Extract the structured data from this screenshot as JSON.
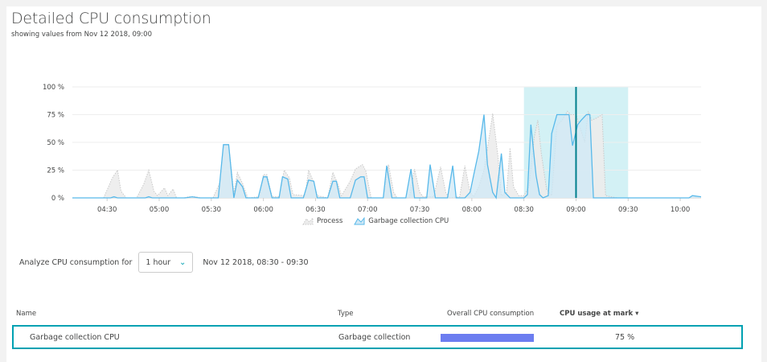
{
  "header": {
    "title": "Detailed CPU consumption",
    "subtitle": "showing values from Nov 12 2018, 09:00"
  },
  "colors": {
    "accent": "#00a1b2",
    "gc_line": "#58b9ea",
    "gc_fill": "#cfe8f6",
    "process_line": "#c8c8c8",
    "process_fill": "#ececec",
    "selection": "#d3f1f5",
    "bar": "#6c7df0"
  },
  "chart_data": {
    "type": "area",
    "title": "",
    "xlabel": "",
    "ylabel": "",
    "x_ticks": [
      "04:30",
      "05:00",
      "05:30",
      "06:00",
      "06:30",
      "07:00",
      "07:30",
      "08:00",
      "08:30",
      "09:00",
      "09:30",
      "10:00"
    ],
    "y_ticks": [
      "0 %",
      "25 %",
      "50 %",
      "75 %",
      "100 %"
    ],
    "x_range": [
      "04:10",
      "10:12"
    ],
    "ylim": [
      0,
      100
    ],
    "grid": true,
    "legend_position": "bottom",
    "selection_range": [
      "08:30",
      "09:30"
    ],
    "marker_time": "09:00",
    "series": [
      {
        "name": "Process",
        "style": "dotted-area",
        "points": [
          [
            "04:10",
            0
          ],
          [
            "04:28",
            0
          ],
          [
            "04:33",
            18
          ],
          [
            "04:36",
            25
          ],
          [
            "04:38",
            6
          ],
          [
            "04:41",
            0
          ],
          [
            "04:47",
            0
          ],
          [
            "04:51",
            12
          ],
          [
            "04:54",
            25
          ],
          [
            "04:57",
            6
          ],
          [
            "04:59",
            2
          ],
          [
            "05:03",
            9
          ],
          [
            "05:05",
            2
          ],
          [
            "05:08",
            8
          ],
          [
            "05:10",
            0
          ],
          [
            "05:14",
            0
          ],
          [
            "05:17",
            1
          ],
          [
            "05:21",
            1
          ],
          [
            "05:24",
            0
          ],
          [
            "05:31",
            0
          ],
          [
            "05:35",
            14
          ],
          [
            "05:37",
            48
          ],
          [
            "05:40",
            48
          ],
          [
            "05:43",
            4
          ],
          [
            "05:45",
            23
          ],
          [
            "05:48",
            13
          ],
          [
            "05:51",
            0
          ],
          [
            "05:58",
            1
          ],
          [
            "06:00",
            21
          ],
          [
            "06:02",
            21
          ],
          [
            "06:05",
            1
          ],
          [
            "06:09",
            1
          ],
          [
            "06:12",
            25
          ],
          [
            "06:15",
            18
          ],
          [
            "06:17",
            3
          ],
          [
            "06:24",
            2
          ],
          [
            "06:26",
            25
          ],
          [
            "06:29",
            14
          ],
          [
            "06:31",
            2
          ],
          [
            "06:37",
            0
          ],
          [
            "06:40",
            23
          ],
          [
            "06:43",
            12
          ],
          [
            "06:45",
            2
          ],
          [
            "06:50",
            15
          ],
          [
            "06:53",
            26
          ],
          [
            "06:57",
            30
          ],
          [
            "06:59",
            24
          ],
          [
            "07:02",
            0
          ],
          [
            "07:09",
            0
          ],
          [
            "07:12",
            30
          ],
          [
            "07:15",
            5
          ],
          [
            "07:17",
            0
          ],
          [
            "07:24",
            0
          ],
          [
            "07:27",
            26
          ],
          [
            "07:30",
            5
          ],
          [
            "07:32",
            1
          ],
          [
            "07:38",
            1
          ],
          [
            "07:42",
            28
          ],
          [
            "07:45",
            5
          ],
          [
            "07:47",
            0
          ],
          [
            "07:53",
            1
          ],
          [
            "07:56",
            29
          ],
          [
            "07:59",
            5
          ],
          [
            "08:01",
            1
          ],
          [
            "08:04",
            10
          ],
          [
            "08:07",
            25
          ],
          [
            "08:10",
            55
          ],
          [
            "08:12",
            76
          ],
          [
            "08:15",
            38
          ],
          [
            "08:17",
            2
          ],
          [
            "08:20",
            5
          ],
          [
            "08:22",
            45
          ],
          [
            "08:24",
            10
          ],
          [
            "08:27",
            2
          ],
          [
            "08:30",
            2
          ],
          [
            "08:33",
            10
          ],
          [
            "08:36",
            55
          ],
          [
            "08:38",
            70
          ],
          [
            "08:40",
            40
          ],
          [
            "08:43",
            8
          ],
          [
            "08:46",
            2
          ],
          [
            "08:49",
            65
          ],
          [
            "08:52",
            70
          ],
          [
            "08:55",
            78
          ],
          [
            "08:57",
            75
          ],
          [
            "09:00",
            75
          ],
          [
            "09:02",
            65
          ],
          [
            "09:05",
            50
          ],
          [
            "09:07",
            78
          ],
          [
            "09:09",
            70
          ],
          [
            "09:12",
            72
          ],
          [
            "09:15",
            75
          ],
          [
            "09:17",
            2
          ],
          [
            "09:20",
            1
          ],
          [
            "09:24",
            0
          ],
          [
            "09:30",
            0
          ],
          [
            "09:37",
            0
          ],
          [
            "10:12",
            0
          ]
        ]
      },
      {
        "name": "Garbage collection CPU",
        "style": "solid-area",
        "points": [
          [
            "04:10",
            0
          ],
          [
            "04:32",
            0
          ],
          [
            "04:34",
            1
          ],
          [
            "04:36",
            0
          ],
          [
            "04:52",
            0
          ],
          [
            "04:54",
            1
          ],
          [
            "04:56",
            0
          ],
          [
            "05:15",
            0
          ],
          [
            "05:19",
            1
          ],
          [
            "05:23",
            0
          ],
          [
            "05:34",
            0
          ],
          [
            "05:37",
            48
          ],
          [
            "05:40",
            48
          ],
          [
            "05:43",
            0
          ],
          [
            "05:45",
            16
          ],
          [
            "05:48",
            10
          ],
          [
            "05:50",
            0
          ],
          [
            "05:57",
            0
          ],
          [
            "06:00",
            19
          ],
          [
            "06:02",
            19
          ],
          [
            "06:05",
            0
          ],
          [
            "06:09",
            0
          ],
          [
            "06:11",
            19
          ],
          [
            "06:14",
            17
          ],
          [
            "06:16",
            0
          ],
          [
            "06:23",
            0
          ],
          [
            "06:26",
            16
          ],
          [
            "06:29",
            15
          ],
          [
            "06:31",
            0
          ],
          [
            "06:37",
            0
          ],
          [
            "06:40",
            15
          ],
          [
            "06:42",
            15
          ],
          [
            "06:44",
            0
          ],
          [
            "06:50",
            0
          ],
          [
            "06:53",
            16
          ],
          [
            "06:56",
            19
          ],
          [
            "06:58",
            19
          ],
          [
            "07:00",
            0
          ],
          [
            "07:09",
            0
          ],
          [
            "07:11",
            29
          ],
          [
            "07:14",
            0
          ],
          [
            "07:22",
            0
          ],
          [
            "07:25",
            26
          ],
          [
            "07:27",
            0
          ],
          [
            "07:34",
            0
          ],
          [
            "07:36",
            30
          ],
          [
            "07:39",
            0
          ],
          [
            "07:46",
            0
          ],
          [
            "07:49",
            29
          ],
          [
            "07:51",
            0
          ],
          [
            "07:56",
            0
          ],
          [
            "07:59",
            5
          ],
          [
            "08:01",
            20
          ],
          [
            "08:04",
            42
          ],
          [
            "08:07",
            75
          ],
          [
            "08:09",
            30
          ],
          [
            "08:12",
            5
          ],
          [
            "08:14",
            0
          ],
          [
            "08:17",
            40
          ],
          [
            "08:19",
            5
          ],
          [
            "08:22",
            0
          ],
          [
            "08:30",
            0
          ],
          [
            "08:32",
            3
          ],
          [
            "08:34",
            66
          ],
          [
            "08:37",
            20
          ],
          [
            "08:39",
            3
          ],
          [
            "08:41",
            0
          ],
          [
            "08:44",
            2
          ],
          [
            "08:46",
            58
          ],
          [
            "08:49",
            75
          ],
          [
            "08:51",
            75
          ],
          [
            "08:53",
            75
          ],
          [
            "08:56",
            75
          ],
          [
            "08:58",
            47
          ],
          [
            "09:01",
            66
          ],
          [
            "09:03",
            70
          ],
          [
            "09:06",
            75
          ],
          [
            "09:08",
            75
          ],
          [
            "09:10",
            0
          ],
          [
            "09:30",
            0
          ],
          [
            "10:05",
            0
          ],
          [
            "10:07",
            2
          ],
          [
            "10:12",
            1
          ]
        ]
      }
    ]
  },
  "legend": {
    "process": "Process",
    "gc": "Garbage collection CPU",
    "process_icon": "area-dotted-icon",
    "gc_icon": "area-solid-icon"
  },
  "analyze": {
    "label": "Analyze CPU consumption for",
    "selected": "1 hour",
    "range_text": "Nov 12 2018, 08:30 - 09:30"
  },
  "table": {
    "columns": [
      "Name",
      "Type",
      "Overall CPU consumption",
      "CPU usage at mark ▾"
    ],
    "rows": [
      {
        "name": "Garbage collection CPU",
        "type": "Garbage collection",
        "overall_fraction": 1.0,
        "usage": "75 %"
      }
    ]
  }
}
